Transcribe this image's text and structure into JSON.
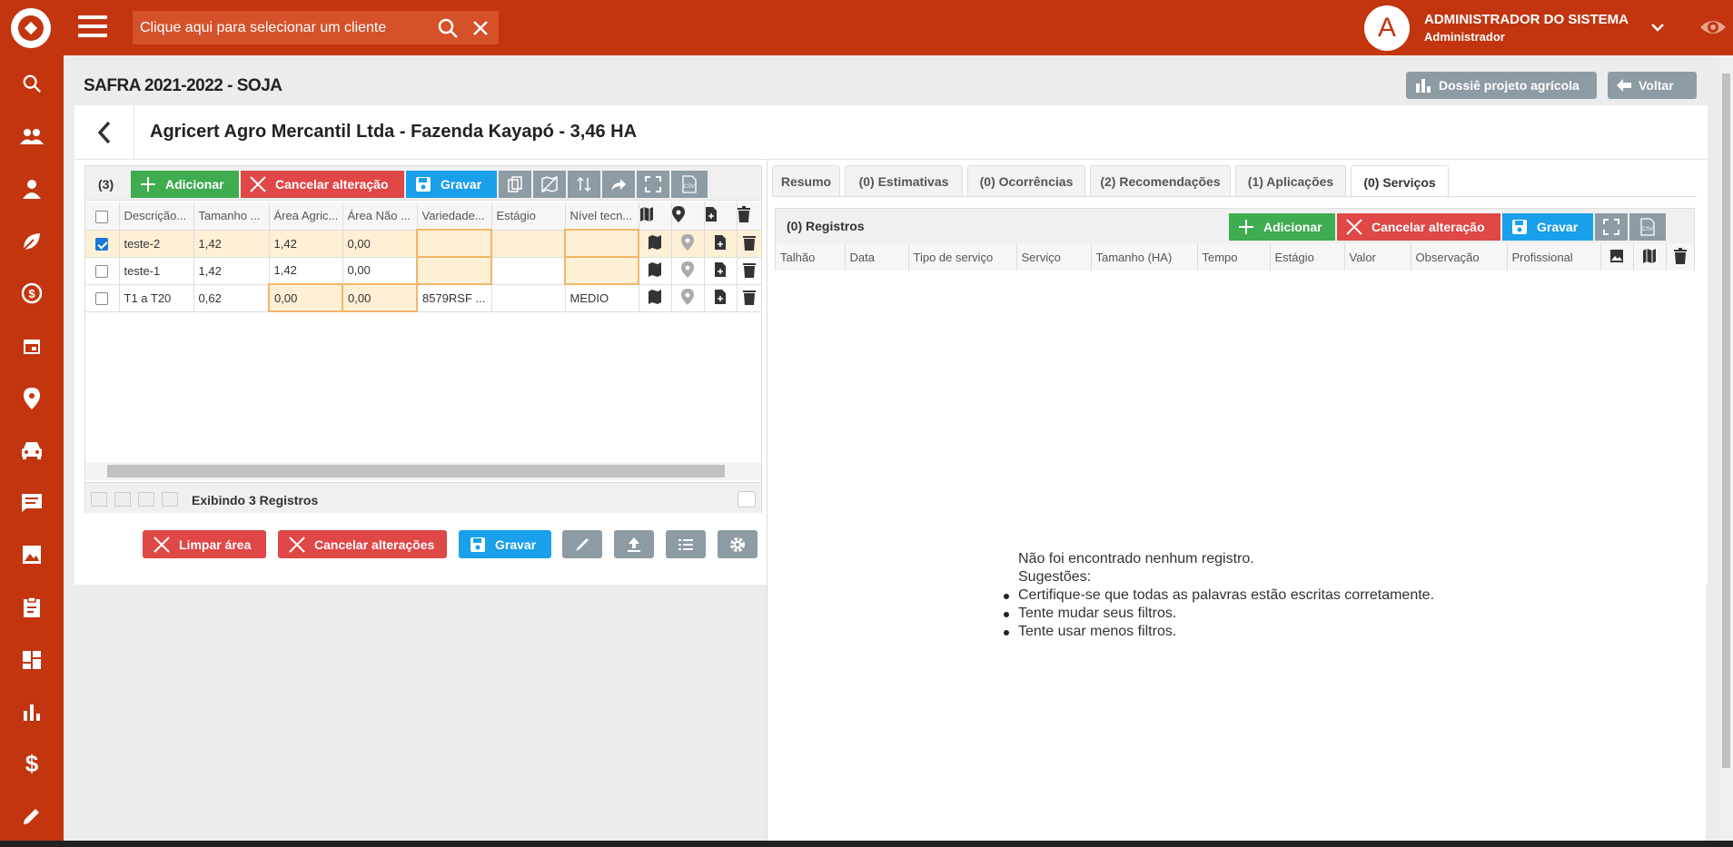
{
  "topbar": {
    "client_placeholder": "Clique aqui para selecionar um cliente",
    "user_initial": "A",
    "user_name": "ADMINISTRADOR DO SISTEMA",
    "user_role": "Administrador",
    "brand_color": "#c2350f"
  },
  "sidebar": {
    "items": [
      "search-icon",
      "people-icon",
      "person-icon",
      "leaf-icon",
      "money-cycle-icon",
      "calendar-icon",
      "location-pin-icon",
      "car-icon",
      "chat-icon",
      "image-icon",
      "clipboard-icon",
      "dashboard-icon",
      "bar-chart-icon",
      "dollar-icon",
      "pencil-icon"
    ]
  },
  "page": {
    "title": "SAFRA 2021-2022 - SOJA",
    "dossie_label": "Dossiê projeto agrícola",
    "voltar_label": "Voltar",
    "card_title": "Agricert Agro Mercantil Ltda - Fazenda Kayapó - 3,46 HA"
  },
  "left_grid": {
    "count": "(3)",
    "add_label": "Adicionar",
    "cancel_label": "Cancelar alteração",
    "save_label": "Gravar",
    "columns": [
      "Descrição...",
      "Tamanho ...",
      "Área Agric...",
      "Área Não ...",
      "Variedade...",
      "Estágio",
      "Nível tecn..."
    ],
    "rows": [
      {
        "desc": "teste-2",
        "tam": "1,42",
        "area_agric": "1,42",
        "area_nao": "0,00",
        "variedade": "",
        "estagio": "",
        "nivel": "",
        "checked": true
      },
      {
        "desc": "teste-1",
        "tam": "1,42",
        "area_agric": "1,42",
        "area_nao": "0,00",
        "variedade": "",
        "estagio": "",
        "nivel": "",
        "checked": false
      },
      {
        "desc": "T1 a T20",
        "tam": "0,62",
        "area_agric": "0,00",
        "area_nao": "0,00",
        "variedade": "8579RSF ...",
        "estagio": "",
        "nivel": "MEDIO",
        "checked": false
      }
    ],
    "pager_text": "Exibindo 3 Registros"
  },
  "bottom_actions": {
    "limpar_label": "Limpar área",
    "cancelar_label": "Cancelar alterações",
    "gravar_label": "Gravar"
  },
  "right_panel": {
    "tabs": [
      "Resumo",
      "(0) Estimativas",
      "(0) Ocorrências",
      "(2) Recomendações",
      "(1) Aplicações",
      "(0) Serviços"
    ],
    "active_tab": "(0) Serviços",
    "registros_label": "(0) Registros",
    "add_label": "Adicionar",
    "cancel_label": "Cancelar alteração",
    "save_label": "Gravar",
    "columns": [
      "Talhão",
      "Data",
      "Tipo de serviço",
      "Serviço",
      "Tamanho (HA)",
      "Tempo",
      "Estágio",
      "Valor",
      "Observação",
      "Profissional"
    ],
    "empty_title": "Não foi encontrado nenhum registro.",
    "empty_sub": "Sugestões:",
    "suggestions": [
      "Certifique-se que todas as palavras estão escritas corretamente.",
      "Tente mudar seus filtros.",
      "Tente usar menos filtros."
    ]
  }
}
